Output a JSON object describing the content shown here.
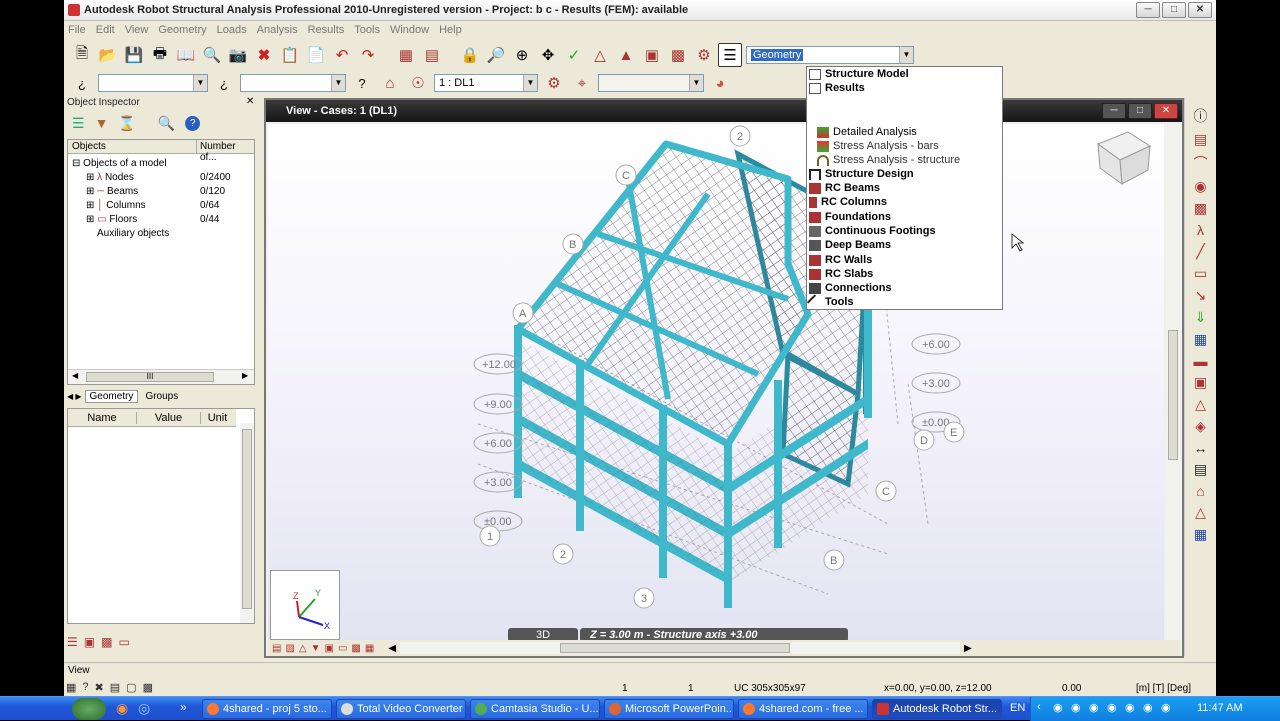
{
  "window": {
    "title": "Autodesk Robot Structural Analysis Professional 2010-Unregistered version - Project: b c - Results (FEM): available"
  },
  "menu": [
    "File",
    "Edit",
    "View",
    "Geometry",
    "Loads",
    "Analysis",
    "Results",
    "Tools",
    "Window",
    "Help"
  ],
  "toolbar": {
    "layout_value": "Geometry",
    "case_value": "1 : DL1"
  },
  "inspector": {
    "title": "Object Inspector",
    "col_objects": "Objects",
    "col_number": "Number of...",
    "root": "Objects of a model",
    "items": [
      {
        "label": "Nodes",
        "count": "0/2400"
      },
      {
        "label": "Beams",
        "count": "0/120"
      },
      {
        "label": "Columns",
        "count": "0/64"
      },
      {
        "label": "Floors",
        "count": "0/44"
      }
    ],
    "auxiliary": "Auxiliary objects",
    "tabs": [
      "Geometry",
      "Groups"
    ],
    "props_cols": [
      "Name",
      "Value",
      "Unit"
    ],
    "scroll_mark": "III"
  },
  "view": {
    "title": "View - Cases: 1 (DL1)",
    "mode": "3D",
    "status": "Z = 3.00 m - Structure axis +3.00"
  },
  "axis_labels": {
    "levels_left": [
      "+12.00",
      "+9.00",
      "+6.00",
      "+3.00",
      "±0.00"
    ],
    "levels_right": [
      "+6.00",
      "+3.00",
      "±0.00"
    ],
    "grid_left": [
      "A",
      "B",
      "C"
    ],
    "grid_bottom": [
      "1",
      "2",
      "3"
    ],
    "grid_right": [
      "D",
      "E",
      "C",
      "B"
    ],
    "grid_top": [
      "2"
    ]
  },
  "dropdown": {
    "items": [
      {
        "label": "Structure Model",
        "bold": true
      },
      {
        "label": "Results",
        "bold": true
      },
      {
        "label": "Detailed Analysis",
        "bold": false
      },
      {
        "label": "Stress Analysis - bars",
        "bold": false
      },
      {
        "label": "Stress Analysis - structure",
        "bold": false
      },
      {
        "label": "Structure Design",
        "bold": true
      },
      {
        "label": "RC Beams",
        "bold": true
      },
      {
        "label": "RC Columns",
        "bold": true
      },
      {
        "label": "Foundations",
        "bold": true
      },
      {
        "label": "Continuous Footings",
        "bold": true
      },
      {
        "label": "Deep Beams",
        "bold": true
      },
      {
        "label": "RC Walls",
        "bold": true
      },
      {
        "label": "RC Slabs",
        "bold": true
      },
      {
        "label": "Connections",
        "bold": true
      },
      {
        "label": "Tools",
        "bold": true
      }
    ]
  },
  "statusbar": {
    "view_label": "View",
    "num1": "1",
    "num2": "1",
    "section": "UC 305x305x97",
    "coords": "x=0.00, y=0.00, z=12.00",
    "angle": "0.00",
    "units": "[m] [T] [Deg]"
  },
  "taskbar": {
    "buttons": [
      "4shared - proj 5 sto...",
      "Total Video Converter",
      "Camtasia Studio - U...",
      "Microsoft PowerPoin...",
      "4shared.com - free ...",
      "Autodesk Robot Str..."
    ],
    "lang": "EN",
    "time": "11:47 AM"
  }
}
